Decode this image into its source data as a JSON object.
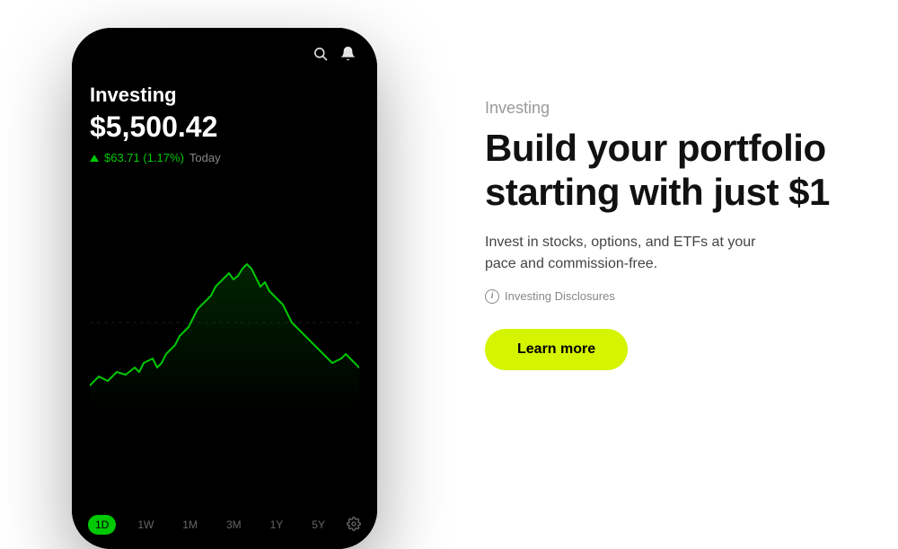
{
  "left": {
    "phone": {
      "icons": {
        "search": "🔍",
        "bell": "🔔"
      },
      "title": "Investing",
      "amount": "$5,500.42",
      "change": "$63.71 (1.17%)",
      "period": "Today",
      "tabs": [
        "1D",
        "1W",
        "1M",
        "3M",
        "1Y",
        "5Y"
      ],
      "active_tab": "1D"
    }
  },
  "right": {
    "section_label": "Investing",
    "headline_line1": "Build your portfolio",
    "headline_line2": "starting with just $1",
    "description": "Invest in stocks, options, and ETFs at your pace and commission-free.",
    "disclosures_label": "Investing Disclosures",
    "cta_label": "Learn more"
  }
}
